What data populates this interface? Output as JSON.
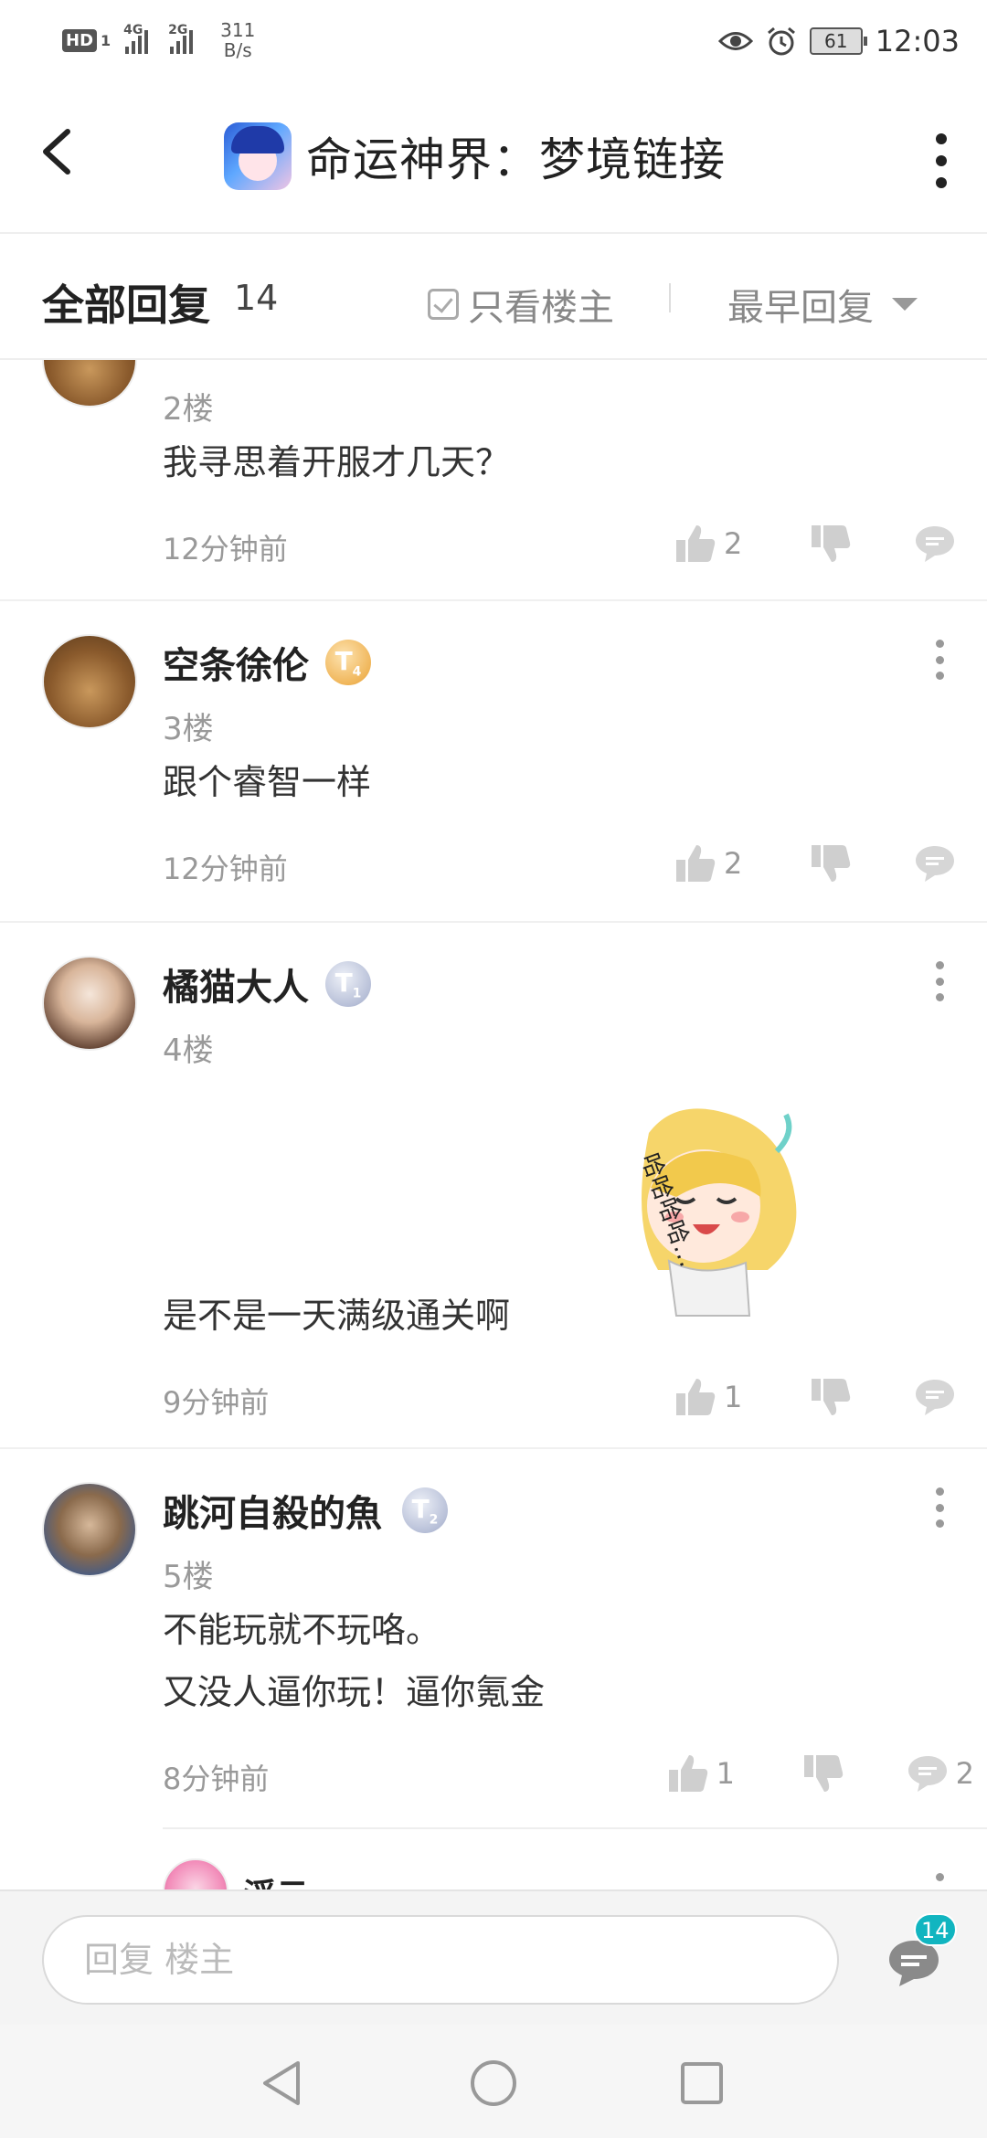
{
  "status_bar": {
    "hd_label": "HD",
    "hd_sub": "1",
    "net1": "4G",
    "net2": "2G",
    "speed_value": "311",
    "speed_unit": "B/s",
    "battery": "61",
    "time": "12:03"
  },
  "header": {
    "title": "命运神界：梦境链接"
  },
  "filter_bar": {
    "all_replies_label": "全部回复",
    "count": "14",
    "only_op_label": "只看楼主",
    "sort_label": "最早回复"
  },
  "comments": [
    {
      "floor": "2楼",
      "text": "我寻思着开服才几天？",
      "time": "12分钟前",
      "likes": "2"
    },
    {
      "username": "空条徐伦",
      "badge": "T",
      "badge_level": "4",
      "floor": "3楼",
      "text": "跟个睿智一样",
      "time": "12分钟前",
      "likes": "2"
    },
    {
      "username": "橘猫大人",
      "badge": "T",
      "badge_level": "1",
      "floor": "4楼",
      "text": "是不是一天满级通关啊",
      "sticker_text": "哈哈哈哈…",
      "time": "9分钟前",
      "likes": "1"
    },
    {
      "username": "跳河自殺的魚",
      "badge": "T",
      "badge_level": "2",
      "floor": "5楼",
      "line1": "不能玩就不玩咯。",
      "line2": "又没人逼你玩！逼你氪金",
      "time": "8分钟前",
      "likes": "1",
      "replies": "2"
    }
  ],
  "sub_reply": {
    "username": "浮云"
  },
  "input_bar": {
    "placeholder": "回复  楼主",
    "badge_count": "14"
  },
  "colors": {
    "accent_badge": "#11b5c0",
    "gold_badge": "#f0b65a",
    "silver_badge": "#b8c0d8"
  }
}
